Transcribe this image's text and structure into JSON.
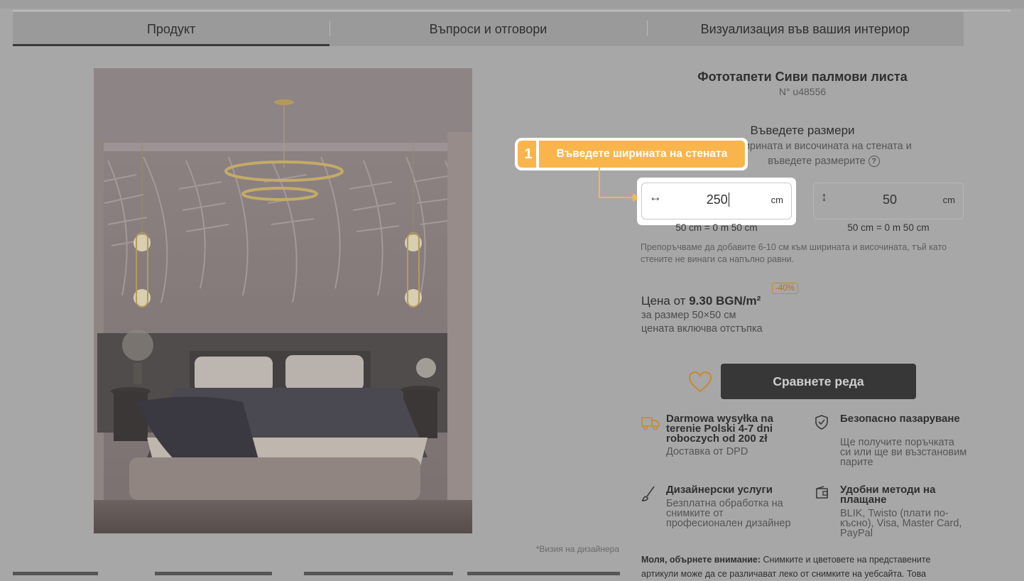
{
  "tabs": [
    {
      "label": "Продукт",
      "active": true
    },
    {
      "label": "Въпроси и отговори",
      "active": false
    },
    {
      "label": "Визуализация във вашия интериор",
      "active": false
    }
  ],
  "product": {
    "title": "Фототапети Сиви палмови листа",
    "sku": "N° u48556",
    "image_caption": "*Визия на дизайнера"
  },
  "dimensions": {
    "heading": "Въведете размери",
    "subtitle_line1": "ширината и височината на стената и",
    "subtitle_line2": "въведете размерите",
    "help_icon": "?",
    "width": {
      "icon": "↔",
      "value": "250",
      "unit": "cm",
      "conversion": "50 cm = 0 m 50 cm"
    },
    "height": {
      "icon": "↕",
      "value": "50",
      "unit": "cm",
      "conversion": "50 cm = 0 m 50 cm"
    },
    "recommendation": "Препоръчваме да добавите 6-10 см към ширината и височината, тъй като стените не винаги са напълно равни."
  },
  "tooltip": {
    "step": "1",
    "text": "Въведете ширината на стената"
  },
  "price": {
    "prefix": "Цена от",
    "amount": "9.30 BGN/m²",
    "discount": "-40%",
    "size_note": "за размер 50×50 см",
    "discount_note": "цената включва отстъпка"
  },
  "actions": {
    "compare_label": "Сравнете реда",
    "wishlist_icon": "heart-icon"
  },
  "features": [
    {
      "icon": "truck-icon",
      "title": "Darmowa wysyłka na terenie Polski 4-7 dni roboczych od 200 zł",
      "desc": "Доставка от DPD"
    },
    {
      "icon": "shield-icon",
      "title": "Безопасно пазаруване",
      "desc": "Ще получите поръчката си или ще ви възстановим парите"
    },
    {
      "icon": "brush-icon",
      "title": "Дизайнерски услуги",
      "desc": "Безплатна обработка на снимките от професионален дизайнер"
    },
    {
      "icon": "wallet-icon",
      "title": "Удобни методи на плащане",
      "desc": "BLIK, Twisto (плати по-късно), Visa, Master Card, PayPal"
    }
  ],
  "notice": {
    "bold": "Моля, обърнете внимание:",
    "text": " Снимките и цветовете на представените артикули може да се различават леко от снимките на уебсайта. Това"
  },
  "colors": {
    "overlay": "#a7a7a7",
    "accent": "#f9b54c",
    "cta": "#373737"
  }
}
